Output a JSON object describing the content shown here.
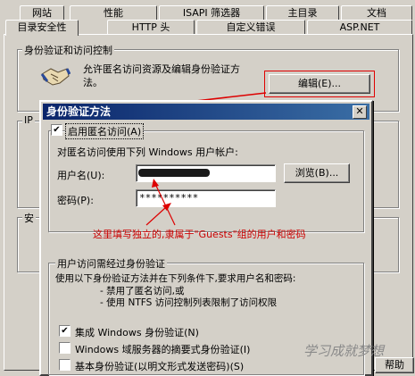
{
  "tabs_row1": [
    "网站",
    "性能",
    "ISAPI 筛选器",
    "主目录",
    "文档"
  ],
  "tabs_row2": [
    "目录安全性",
    "HTTP 头",
    "自定义错误",
    "ASP.NET"
  ],
  "auth_group": {
    "title": "身份验证和访问控制",
    "desc_line1": "允许匿名访问资源及编辑身份验证方",
    "desc_line2": "法。",
    "edit_button": "编辑(E)..."
  },
  "bg_fragments": {
    "ip": "IP",
    "an": "安"
  },
  "dialog": {
    "title": "身份验证方法",
    "anonymous_checkbox": "启用匿名访问(A)",
    "anonymous_desc": "对匿名访问使用下列 Windows 用户帐户:",
    "username_label": "用户名(U):",
    "username_value": "",
    "browse_button": "浏览(B)...",
    "password_label": "密码(P):",
    "password_value": "**********",
    "note": "这里填写独立的,隶属于\"Guests\"组的用户和密码",
    "auth_group_title": "用户访问需经过身份验证",
    "auth_desc1": "使用以下身份验证方法并在下列条件下,要求用户名和密码:",
    "auth_desc2": "- 禁用了匿名访问,或",
    "auth_desc3": "- 使用 NTFS 访问控制列表限制了访问权限",
    "check_integrated": "集成 Windows 身份验证(N)",
    "check_digest": "Windows 域服务器的摘要式身份验证(I)",
    "check_basic": "基本身份验证(以明文形式发送密码)(S)",
    "help_button": "帮助"
  },
  "watermark": "学习成就梦想",
  "colors": {
    "annotation": "#cc0000",
    "titlebar": "#0a246a"
  }
}
